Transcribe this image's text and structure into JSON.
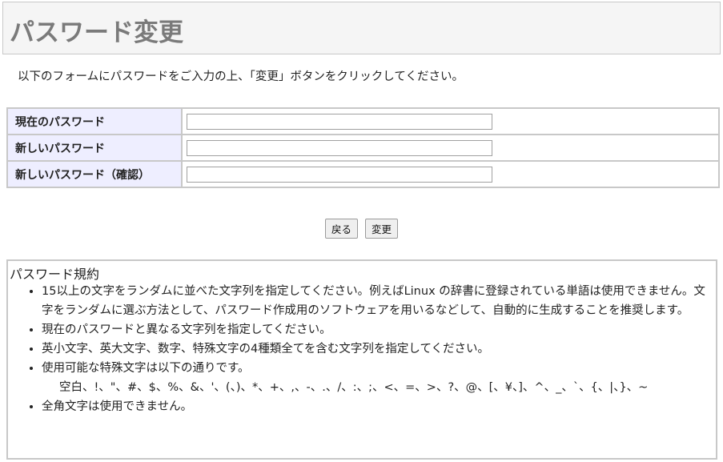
{
  "header": {
    "title": "パスワード変更"
  },
  "instruction": "以下のフォームにパスワードをご入力の上、「変更」ボタンをクリックしてください。",
  "form": {
    "rows": [
      {
        "label": "現在のパスワード",
        "value": ""
      },
      {
        "label": "新しいパスワード",
        "value": ""
      },
      {
        "label": "新しいパスワード（確認）",
        "value": ""
      }
    ]
  },
  "buttons": {
    "back": "戻る",
    "change": "変更"
  },
  "rules": {
    "title": "パスワード規約",
    "items": [
      "15以上の文字をランダムに並べた文字列を指定してください。例えばLinux の辞書に登録されている単語は使用できません。文字をランダムに選ぶ方法として、パスワード作成用のソフトウェアを用いるなどして、自動的に生成することを推奨します。",
      "現在のパスワードと異なる文字列を指定してください。",
      "英小文字、英大文字、数字、特殊文字の4種類全てを含む文字列を指定してください。",
      "使用可能な特殊文字は以下の通りです。",
      "全角文字は使用できません。"
    ],
    "special_chars": "空白、!、\"、#、$、%、&、'、(、)、*、+、,、-、.、/、:、;、<、=、>、?、@、[、¥、]、^、_、`、{、|、}、~"
  }
}
